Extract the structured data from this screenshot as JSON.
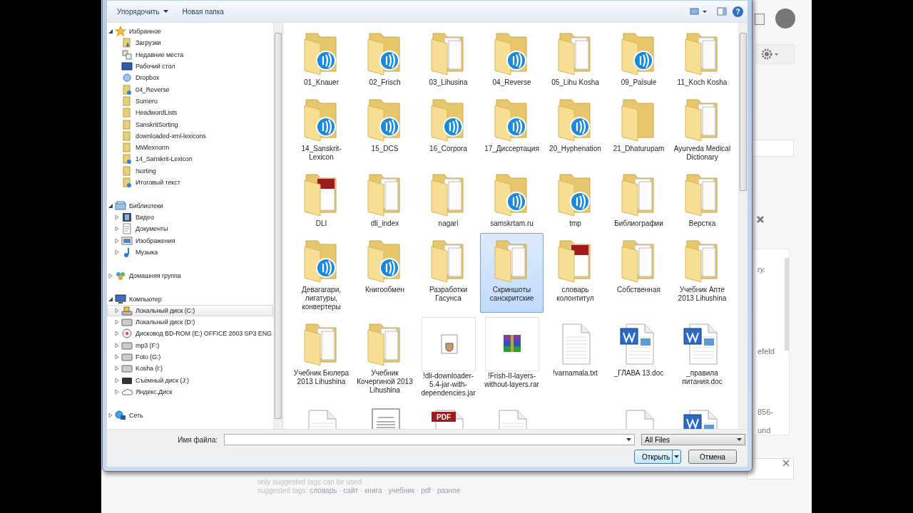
{
  "dialog": {
    "toolbar": {
      "organize_button": "Упорядочить",
      "new_folder_button": "Новая папка",
      "help_button": "?"
    },
    "tree": [
      {
        "label": "Избранное",
        "kind": "star",
        "expanded": true,
        "selected": false,
        "children": [
          {
            "label": "Загрузки",
            "kind": "download",
            "selected": false
          },
          {
            "label": "Недавние места",
            "kind": "recent",
            "selected": false
          },
          {
            "label": "Рабочий стол",
            "kind": "desktop",
            "selected": false
          },
          {
            "label": "Dropbox",
            "kind": "dropbox",
            "selected": false
          },
          {
            "label": "04_Reverse",
            "kind": "folder-shared",
            "selected": false
          },
          {
            "label": "Sumeru",
            "kind": "folder",
            "selected": false
          },
          {
            "label": "HeadwordLists",
            "kind": "folder",
            "selected": false
          },
          {
            "label": "SanskritSorting",
            "kind": "folder",
            "selected": false
          },
          {
            "label": "downloaded-xml-lexicons",
            "kind": "folder",
            "selected": false
          },
          {
            "label": "MWlexnorm",
            "kind": "folder",
            "selected": false
          },
          {
            "label": "14_Sanskrit-Lexicon",
            "kind": "folder-shared",
            "selected": false
          },
          {
            "label": "!sorting",
            "kind": "folder",
            "selected": false
          },
          {
            "label": "Итоговый текст",
            "kind": "folder-shared",
            "selected": false
          }
        ]
      },
      {
        "label": "Библиотеки",
        "kind": "library",
        "expanded": true,
        "selected": false,
        "children": [
          {
            "label": "Видео",
            "kind": "video",
            "expanded": false,
            "selected": false
          },
          {
            "label": "Документы",
            "kind": "documents",
            "expanded": false,
            "selected": false
          },
          {
            "label": "Изображения",
            "kind": "images",
            "expanded": false,
            "selected": false
          },
          {
            "label": "Музыка",
            "kind": "music",
            "expanded": false,
            "selected": false
          }
        ]
      },
      {
        "label": "Домашняя группа",
        "kind": "homegroup",
        "expanded": false,
        "selected": false
      },
      {
        "label": "Компьютер",
        "kind": "computer",
        "expanded": true,
        "selected": false,
        "children": [
          {
            "label": "Локальный диск (C:)",
            "kind": "system-disk",
            "expanded": false,
            "selected": true
          },
          {
            "label": "Локальный диск (D:)",
            "kind": "disk",
            "expanded": false,
            "selected": false
          },
          {
            "label": "Дисковод BD-ROM (E:) OFFICE 2003 SP3 ENG",
            "kind": "optical",
            "expanded": false,
            "selected": false
          },
          {
            "label": "mp3 (F:)",
            "kind": "disk",
            "expanded": false,
            "selected": false
          },
          {
            "label": "Foto (G:)",
            "kind": "disk",
            "expanded": false,
            "selected": false
          },
          {
            "label": "Kosha (I:)",
            "kind": "disk",
            "expanded": false,
            "selected": false
          },
          {
            "label": "Съемный диск (J:)",
            "kind": "removable",
            "expanded": false,
            "selected": false
          },
          {
            "label": "Яндекс.Диск",
            "kind": "cloud",
            "expanded": false,
            "selected": false
          }
        ]
      },
      {
        "label": "Сеть",
        "kind": "network",
        "expanded": false,
        "selected": false
      }
    ],
    "items": [
      {
        "label": "01_Knauer",
        "kind": "folder-audio",
        "selected": false
      },
      {
        "label": "02_Frisch",
        "kind": "folder-audio",
        "selected": false
      },
      {
        "label": "03_Lihusina",
        "kind": "folder-docs",
        "selected": false
      },
      {
        "label": "04_Reverse",
        "kind": "folder-audio",
        "selected": false
      },
      {
        "label": "05_Lihu Kosha",
        "kind": "folder-docs",
        "selected": false
      },
      {
        "label": "09_Palsule",
        "kind": "folder-audio",
        "selected": false
      },
      {
        "label": "11_Koch Kosha",
        "kind": "folder-docs",
        "selected": false
      },
      {
        "label": "14_Sanskrit-Lexicon",
        "kind": "folder-audio",
        "selected": false
      },
      {
        "label": "15_DCS",
        "kind": "folder-audio",
        "selected": false
      },
      {
        "label": "16_Corpora",
        "kind": "folder-audio",
        "selected": false
      },
      {
        "label": "17_Диссертация",
        "kind": "folder-audio",
        "selected": false
      },
      {
        "label": "20_Hyphenation",
        "kind": "folder-audio",
        "selected": false
      },
      {
        "label": "21_Dhaturupam",
        "kind": "folder",
        "selected": false
      },
      {
        "label": "Ayurveda Medical Dictionary",
        "kind": "folder-docs",
        "selected": false
      },
      {
        "label": "DLI",
        "kind": "folder-pdf",
        "selected": false
      },
      {
        "label": "dli_index",
        "kind": "folder-docs",
        "selected": false
      },
      {
        "label": "nagari",
        "kind": "folder-docs",
        "selected": false
      },
      {
        "label": "samskrtam.ru",
        "kind": "folder-audio",
        "selected": false
      },
      {
        "label": "tmp",
        "kind": "folder-audio",
        "selected": false
      },
      {
        "label": "Библиографии",
        "kind": "folder-docs",
        "selected": false
      },
      {
        "label": "Верстка",
        "kind": "folder-docs",
        "selected": false
      },
      {
        "label": "Девагагари, лигатуры, конвертеры",
        "kind": "folder-audio",
        "selected": false
      },
      {
        "label": "Книгообмен",
        "kind": "folder-audio",
        "selected": false
      },
      {
        "label": "Разработки Гасунса",
        "kind": "folder-docs",
        "selected": false
      },
      {
        "label": "Скриншоты санскритские",
        "kind": "folder-docs",
        "selected": true
      },
      {
        "label": "словарь колонтитул",
        "kind": "folder-pdf",
        "selected": false
      },
      {
        "label": "Собственная",
        "kind": "folder-docs",
        "selected": false
      },
      {
        "label": "Учебник Апте 2013 Lihushina",
        "kind": "folder-docs",
        "selected": false
      },
      {
        "label": "Учебник Бюлера 2013 Lihushina",
        "kind": "folder-docs",
        "selected": false
      },
      {
        "label": "Учебник Кочергиной 2013 Lihushina",
        "kind": "folder-docs",
        "selected": false
      },
      {
        "label": "!dli-downloader-5.4-jar-with-dependencies.jar",
        "kind": "jar",
        "selected": false
      },
      {
        "label": "!Frish-II-layers-without-layers.rar",
        "kind": "rar",
        "selected": false
      },
      {
        "label": "!varnamala.txt",
        "kind": "txt",
        "selected": false
      },
      {
        "label": "_ГЛАВА 13.doc",
        "kind": "doc",
        "selected": false
      },
      {
        "label": "_правила питания.doc",
        "kind": "doc",
        "selected": false
      },
      {
        "kind": "txt",
        "selected": false
      },
      {
        "kind": "page",
        "selected": false
      },
      {
        "kind": "pdf",
        "badge": "PDF",
        "selected": false
      },
      {
        "kind": "txt",
        "selected": false
      },
      {
        "kind": "gap",
        "selected": false
      },
      {
        "kind": "blank",
        "selected": false
      },
      {
        "kind": "doc",
        "selected": false
      }
    ],
    "file_name_label": "Имя файла:",
    "file_type": "All Files",
    "open_button": "Открыть",
    "cancel_button": "Отмена"
  },
  "background": {
    "side_fragments": [
      "ry.",
      "efeld",
      "856-",
      "und"
    ],
    "hint": "only suggested tags can be used",
    "tags_label": "suggested tags:",
    "separator": "·",
    "tags": [
      "словарь",
      "сайт",
      "книга",
      "учебник",
      "pdf",
      "разное"
    ]
  }
}
